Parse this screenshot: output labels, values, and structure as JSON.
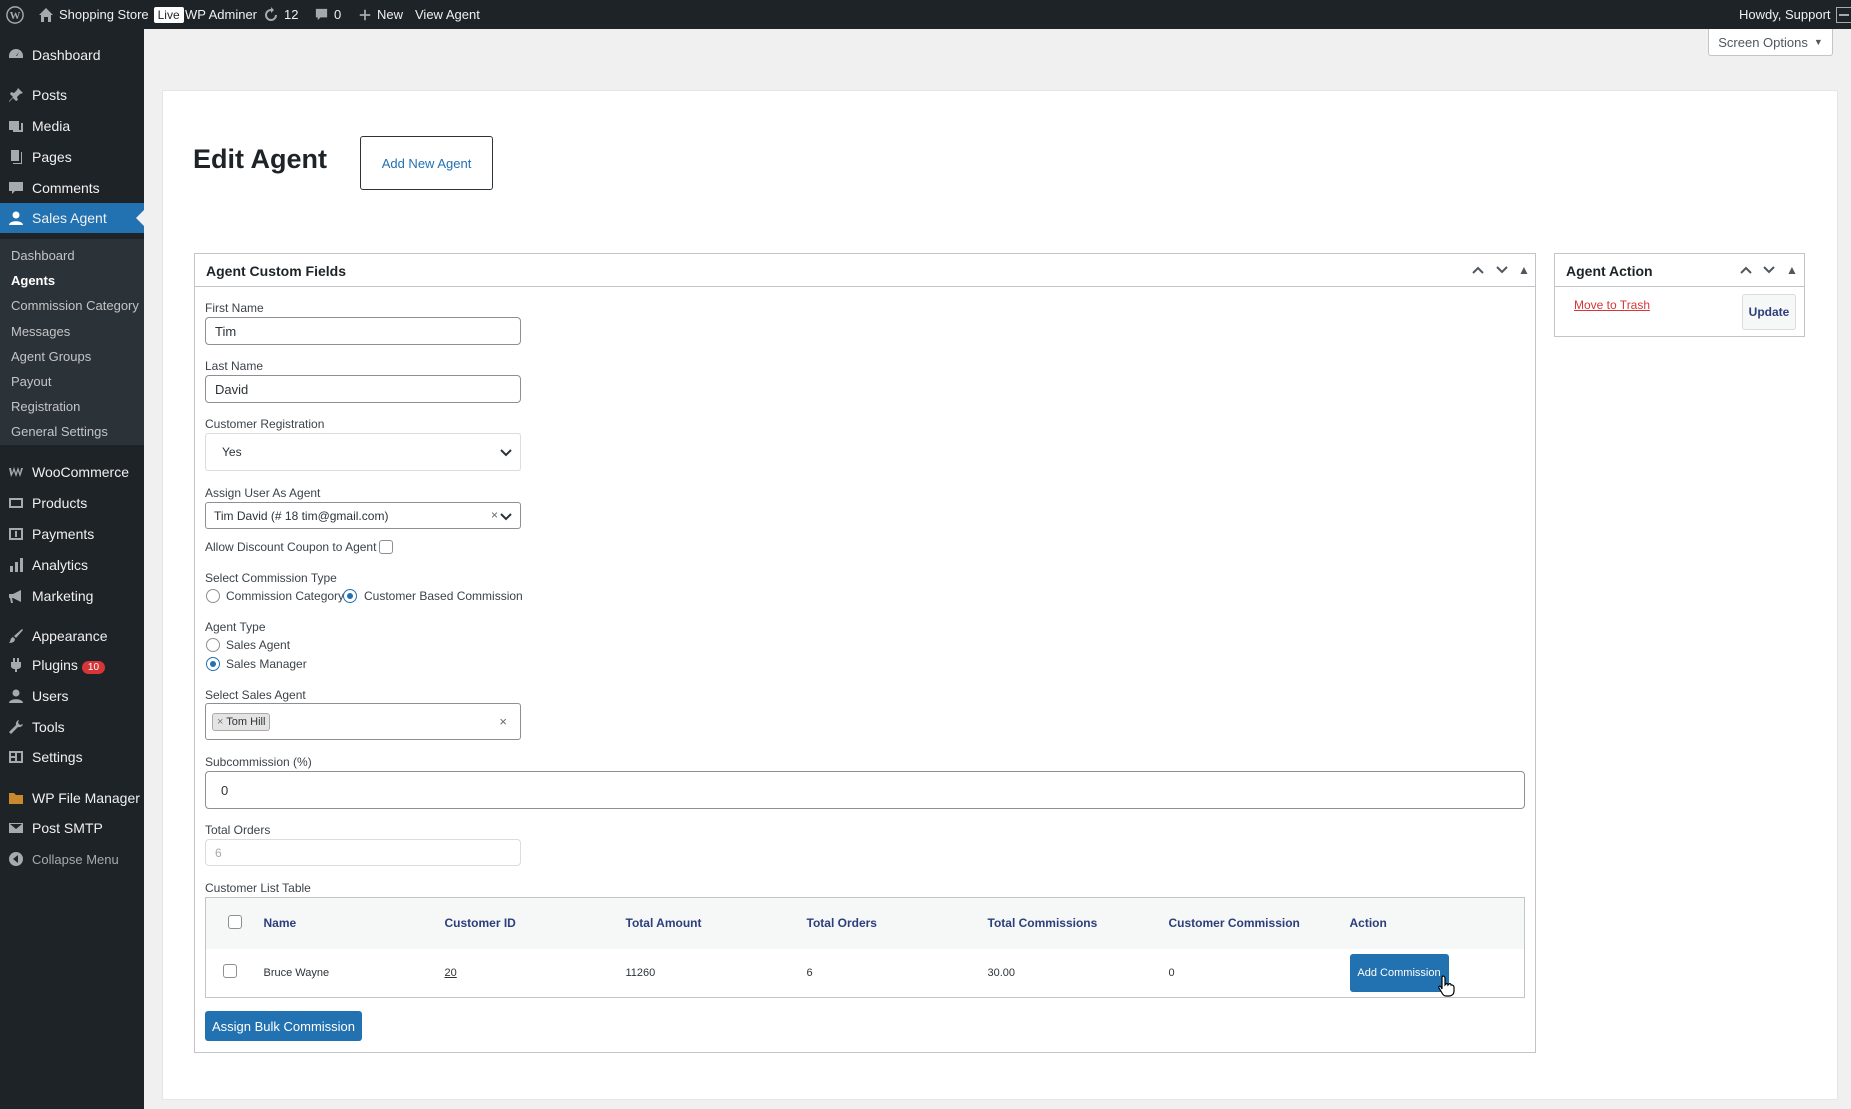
{
  "adminbar": {
    "site_name": "Shopping Store",
    "live_badge": "Live",
    "wp_adminer": "WP Adminer",
    "updates_count": "12",
    "comments_count": "0",
    "new_label": "New",
    "view_agent": "View Agent",
    "howdy": "Howdy, Support"
  },
  "sidebar": {
    "dashboard": "Dashboard",
    "posts": "Posts",
    "media": "Media",
    "pages": "Pages",
    "comments": "Comments",
    "sales_agent": "Sales Agent",
    "submenu": [
      "Dashboard",
      "Agents",
      "Commission Category",
      "Messages",
      "Agent Groups",
      "Payout",
      "Registration",
      "General Settings"
    ],
    "woocommerce": "WooCommerce",
    "products": "Products",
    "payments": "Payments",
    "analytics": "Analytics",
    "marketing": "Marketing",
    "appearance": "Appearance",
    "plugins": "Plugins",
    "plugins_badge": "10",
    "users": "Users",
    "tools": "Tools",
    "settings": "Settings",
    "wp_file_manager": "WP File Manager",
    "post_smtp": "Post SMTP",
    "collapse": "Collapse Menu"
  },
  "screen_options": "Screen Options",
  "page": {
    "title": "Edit Agent",
    "add_new": "Add New Agent"
  },
  "fields_box": {
    "title": "Agent Custom Fields",
    "first_name_label": "First Name",
    "first_name_value": "Tim",
    "last_name_label": "Last Name",
    "last_name_value": "David",
    "customer_registration_label": "Customer Registration",
    "customer_registration_value": "Yes",
    "assign_user_label": "Assign User As Agent",
    "assign_user_value": "Tim David (# 18 tim@gmail.com)",
    "allow_discount_label": "Allow Discount Coupon to Agent",
    "commission_type_label": "Select Commission Type",
    "commission_type_options": [
      "Commission Category",
      "Customer Based Commission"
    ],
    "commission_type_selected": "Customer Based Commission",
    "agent_type_label": "Agent Type",
    "agent_type_options": [
      "Sales Agent",
      "Sales Manager"
    ],
    "agent_type_selected": "Sales Manager",
    "select_sales_agent_label": "Select Sales Agent",
    "selected_sales_agent_tag": "Tom Hill",
    "subcommission_label": "Subcommission (%)",
    "subcommission_value": "0",
    "total_orders_label": "Total Orders",
    "total_orders_value": "6",
    "customer_list_label": "Customer List Table",
    "table": {
      "columns": [
        "Name",
        "Customer ID",
        "Total Amount",
        "Total Orders",
        "Total Commissions",
        "Customer Commission",
        "Action"
      ],
      "rows": [
        {
          "name": "Bruce Wayne",
          "customer_id": "20",
          "total_amount": "11260",
          "total_orders": "6",
          "total_commissions": "30.00",
          "customer_commission": "0",
          "action": "Add Commission"
        }
      ]
    },
    "bulk_button": "Assign Bulk Commission"
  },
  "action_box": {
    "title": "Agent Action",
    "trash_link": "Move to Trash",
    "update_button": "Update"
  },
  "colors": {
    "admin_bar": "#1d2327",
    "accent": "#2271b1",
    "danger": "#d63638"
  }
}
